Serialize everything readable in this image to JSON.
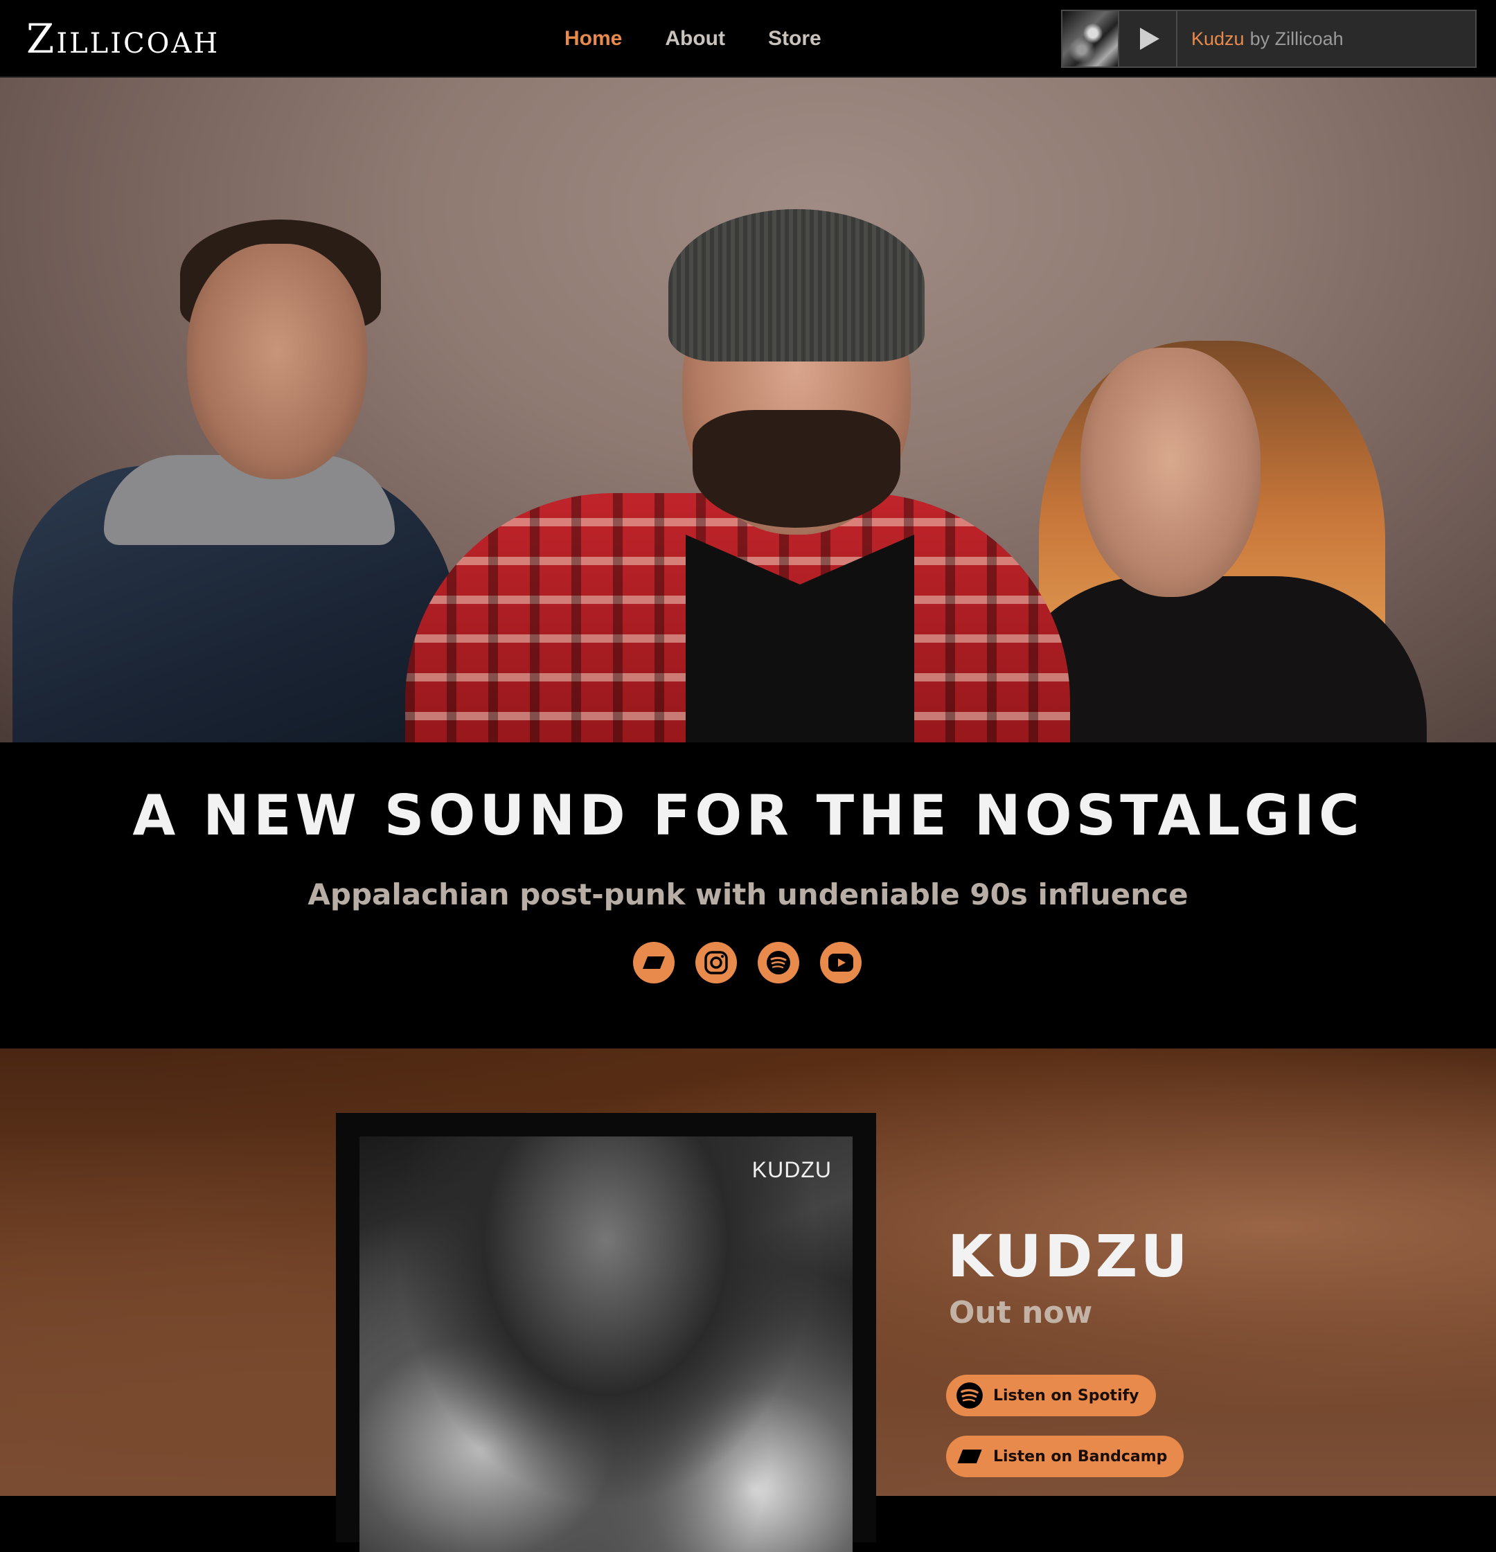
{
  "header": {
    "logo_initial": "Z",
    "logo_rest": "ILLICOAH",
    "nav": [
      {
        "label": "Home",
        "active": true
      },
      {
        "label": "About",
        "active": false
      },
      {
        "label": "Store",
        "active": false
      }
    ],
    "player": {
      "song": "Kudzu",
      "artist_text": "by Zillicoah",
      "thumb_icon": "album-thumbnail",
      "play_icon": "play-icon"
    }
  },
  "hero": {
    "image_alt": "Band photo of three members"
  },
  "tagline": {
    "headline": "A NEW SOUND FOR THE NOSTALGIC",
    "subheadline": "Appalachian post-punk with undeniable 90s influence",
    "socials": [
      {
        "icon": "bandcamp-icon"
      },
      {
        "icon": "instagram-icon"
      },
      {
        "icon": "spotify-icon"
      },
      {
        "icon": "youtube-icon"
      }
    ]
  },
  "release": {
    "cover_text": "KUDZU",
    "title": "KUDZU",
    "subtitle": "Out now",
    "buttons": [
      {
        "label": "Listen on Spotify",
        "icon": "spotify-icon"
      },
      {
        "label": "Listen on Bandcamp",
        "icon": "bandcamp-icon"
      }
    ]
  },
  "colors": {
    "accent": "#e98a4d",
    "background": "#000000",
    "muted_text": "#b9aea6"
  }
}
